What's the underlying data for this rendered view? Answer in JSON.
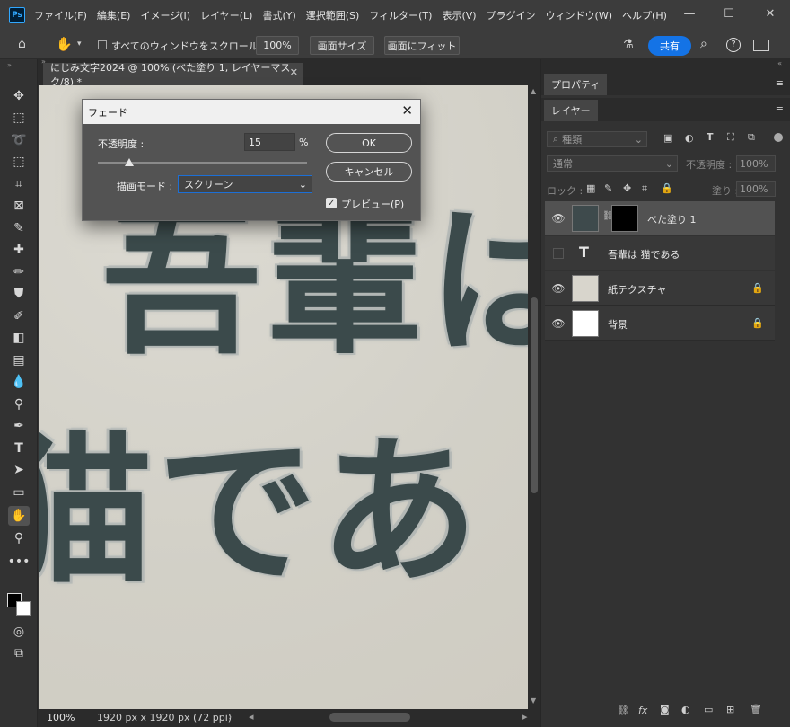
{
  "app": {
    "logo_text": "Ps"
  },
  "menu": [
    "ファイル(F)",
    "編集(E)",
    "イメージ(I)",
    "レイヤー(L)",
    "書式(Y)",
    "選択範囲(S)",
    "フィルター(T)",
    "表示(V)",
    "プラグイン",
    "ウィンドウ(W)",
    "ヘルプ(H)"
  ],
  "options_bar": {
    "scroll_all_label": "すべてのウィンドウをスクロール",
    "zoom_btn": "100%",
    "fit_screen_btn": "画面サイズ",
    "fill_screen_btn": "画面にフィット",
    "share_btn": "共有"
  },
  "document": {
    "tab_title": "にじみ文字2024 @ 100% (べた塗り 1, レイヤーマスク/8) *",
    "canvas_line1": "吾輩は",
    "canvas_line2": "猫であ"
  },
  "status": {
    "zoom": "100%",
    "doc_info": "1920 px x 1920 px (72 ppi)"
  },
  "panels": {
    "properties_tab": "プロパティ",
    "layers_tab": "レイヤー",
    "filter_kind": "種類",
    "blend_mode": "通常",
    "opacity_label": "不透明度 :",
    "opacity_value": "100%",
    "lock_label": "ロック :",
    "fill_label": "塗り :",
    "fill_value": "100%",
    "layers": [
      {
        "name": "べた塗り 1",
        "visible": true,
        "selected": true
      },
      {
        "name": "吾輩は 猫である",
        "visible": false,
        "type": "text"
      },
      {
        "name": "紙テクスチャ",
        "visible": true,
        "locked": true
      },
      {
        "name": "背景",
        "visible": true,
        "locked": true
      }
    ]
  },
  "dialog": {
    "title": "フェード",
    "opacity_label": "不透明度 :",
    "opacity_value": "15",
    "percent": "%",
    "slider_fraction": 0.15,
    "mode_label": "描画モード :",
    "mode_value": "スクリーン",
    "ok_btn": "OK",
    "cancel_btn": "キャンセル",
    "preview_label": "プレビュー(P)",
    "preview_checked": true
  }
}
